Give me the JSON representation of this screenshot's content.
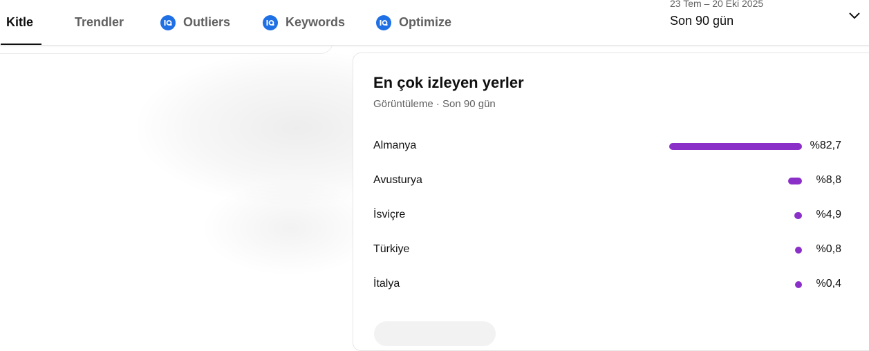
{
  "tabs": [
    {
      "label": "Kitle",
      "active": true,
      "icon": null
    },
    {
      "label": "Trendler",
      "active": false,
      "icon": null
    },
    {
      "label": "Outliers",
      "active": false,
      "icon": "vidiq-icon"
    },
    {
      "label": "Keywords",
      "active": false,
      "icon": "vidiq-icon"
    },
    {
      "label": "Optimize",
      "active": false,
      "icon": "vidiq-icon"
    }
  ],
  "date_selector": {
    "range": "23 Tem – 20 Eki 2025",
    "period": "Son 90 gün",
    "icon": "chevron-down-icon"
  },
  "card": {
    "title": "En çok izleyen yerler",
    "subtitle": "Görüntüleme · Son 90 gün",
    "bar_color": "#8b2fc9",
    "rows": [
      {
        "country": "Almanya",
        "percent_label": "%82,7",
        "percent": 82.7
      },
      {
        "country": "Avusturya",
        "percent_label": "%8,8",
        "percent": 8.8
      },
      {
        "country": "İsviçre",
        "percent_label": "%4,9",
        "percent": 4.9
      },
      {
        "country": "Türkiye",
        "percent_label": "%0,8",
        "percent": 0.8
      },
      {
        "country": "İtalya",
        "percent_label": "%0,4",
        "percent": 0.4
      }
    ]
  }
}
